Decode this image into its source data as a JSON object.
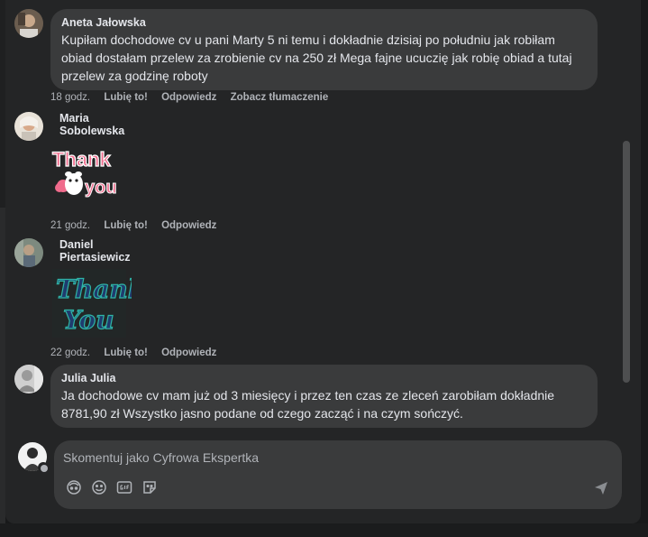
{
  "composer": {
    "placeholder": "Skomentuj jako Cyfrowa Ekspertka",
    "tools": [
      "avatar-sticker-icon",
      "emoji-icon",
      "gif-icon",
      "sticker-icon"
    ],
    "send_icon": "send-icon"
  },
  "comments": [
    {
      "author": "Aneta Jałowska",
      "text": "Kupiłam dochodowe cv u pani Marty 5 ni temu i dokładnie dzisiaj po południu jak robiłam obiad dostałam przelew za zrobienie cv na 250 zł Mega fajne ucuczię jak robię obiad a tutaj przelew za godzinę roboty",
      "time": "18 godz.",
      "like": "Lubię to!",
      "reply": "Odpowiedz",
      "translate": "Zobacz tłumaczenie"
    },
    {
      "author": "Maria Sobolewska",
      "sticker_text": [
        "Thank",
        "you"
      ],
      "time": "21 godz.",
      "like": "Lubię to!",
      "reply": "Odpowiedz"
    },
    {
      "author": "Daniel Piertasiewicz",
      "sticker_text": [
        "Thank",
        "You"
      ],
      "time": "22 godz.",
      "like": "Lubię to!",
      "reply": "Odpowiedz"
    },
    {
      "author": "Julia Julia",
      "text": "Ja dochodowe cv mam już od 3 miesięcy i przez ten czas ze zleceń zarobiłam dokładnie 8781,90 zł Wszystko jasno podane od czego zacząć i na czym sończyć."
    }
  ],
  "colors": {
    "panel": "#242526",
    "bubble": "#3a3b3c",
    "text": "#e4e6eb",
    "muted": "#b0b3b8",
    "sticker_pink": "#f06b8c",
    "sticker_teal": "#2fb5a6"
  }
}
